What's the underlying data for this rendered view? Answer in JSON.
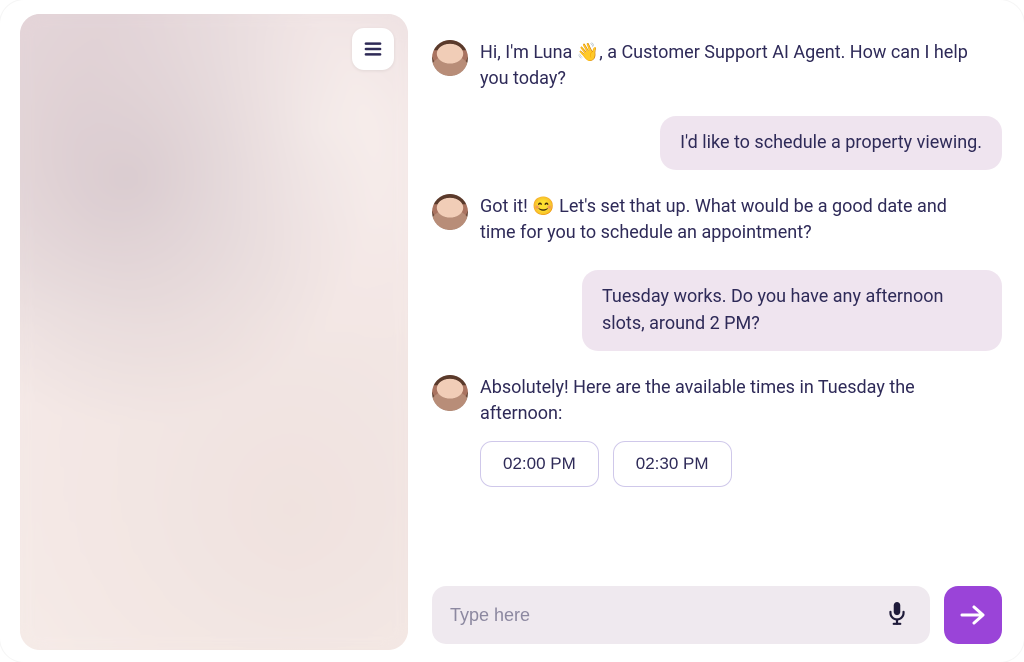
{
  "chat": {
    "messages": [
      {
        "role": "agent",
        "pre": "Hi, I'm Luna ",
        "emoji": "👋",
        "post": ", a Customer Support AI Agent. How can I help you today?"
      },
      {
        "role": "user",
        "text": "I'd like to schedule a property viewing."
      },
      {
        "role": "agent",
        "pre": "Got it! ",
        "emoji": "😊",
        "post": " Let's set that up. What would be a good date and time for you to schedule an appointment?"
      },
      {
        "role": "user",
        "text": "Tuesday works. Do you have any afternoon slots, around 2 PM?"
      },
      {
        "role": "agent",
        "text": "Absolutely! Here are the available times in Tuesday the afternoon:",
        "slots": [
          "02:00 PM",
          "02:30 PM"
        ]
      }
    ]
  },
  "composer": {
    "placeholder": "Type here",
    "value": ""
  },
  "colors": {
    "accent": "#9a44d8",
    "text": "#2e2a58",
    "userBubble": "#efe4ef",
    "inputBg": "#efe9ef"
  }
}
